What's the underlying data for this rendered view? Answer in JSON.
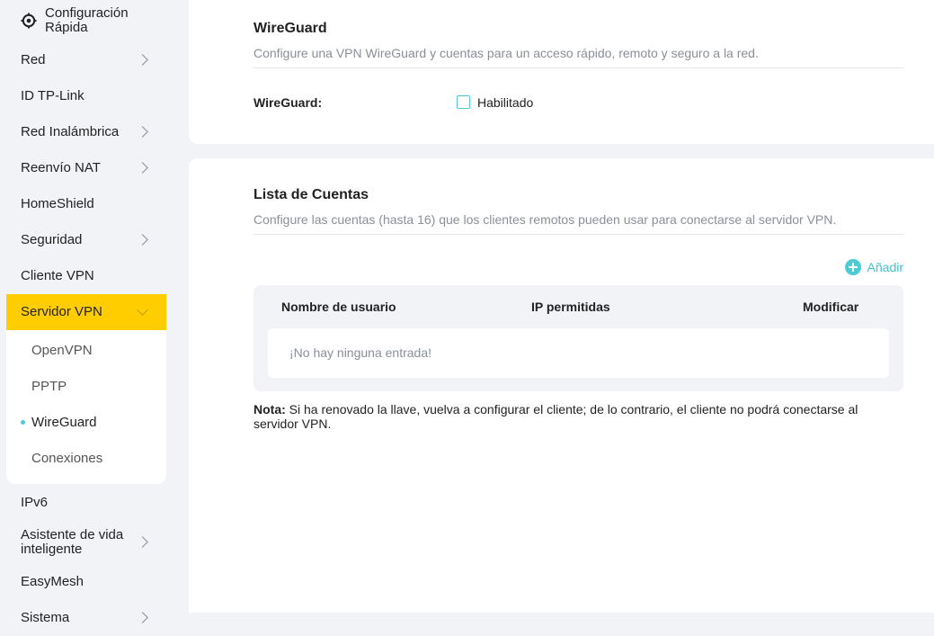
{
  "sidebar": {
    "items": [
      {
        "label": "Configuración Rápida",
        "icon": "gear-icon"
      },
      {
        "label": "Red"
      },
      {
        "label": "ID TP-Link"
      },
      {
        "label": "Red Inalámbrica"
      },
      {
        "label": "Reenvío NAT"
      },
      {
        "label": "HomeShield"
      },
      {
        "label": "Seguridad"
      },
      {
        "label": "Cliente VPN"
      },
      {
        "label": "Servidor VPN"
      },
      {
        "label": "IPv6"
      },
      {
        "label": "Asistente de vida inteligente"
      },
      {
        "label": "EasyMesh"
      },
      {
        "label": "Sistema"
      }
    ],
    "submenu": [
      {
        "label": "OpenVPN"
      },
      {
        "label": "PPTP"
      },
      {
        "label": "WireGuard"
      },
      {
        "label": "Conexiones"
      }
    ]
  },
  "wireguard": {
    "title": "WireGuard",
    "description": "Configure una VPN WireGuard y cuentas para un acceso rápido, remoto y seguro a la red.",
    "field_label": "WireGuard:",
    "checkbox_label": "Habilitado",
    "enabled": false
  },
  "accounts": {
    "title": "Lista de Cuentas",
    "description": "Configure las cuentas (hasta 16) que los clientes remotos pueden usar para conectarse al servidor VPN.",
    "add_label": "Añadir",
    "columns": [
      "Nombre de usuario",
      "IP permitidas",
      "Modificar"
    ],
    "empty_text": "¡No hay ninguna entrada!",
    "note_label": "Nota:",
    "note_text": "Si ha renovado la llave, vuelva a configurar el cliente; de lo contrario, el cliente no podrá conectarse al servidor VPN."
  },
  "colors": {
    "active_bg": "#ffcd00",
    "accent": "#4acbd6",
    "page_bg": "#f1f3f6"
  }
}
